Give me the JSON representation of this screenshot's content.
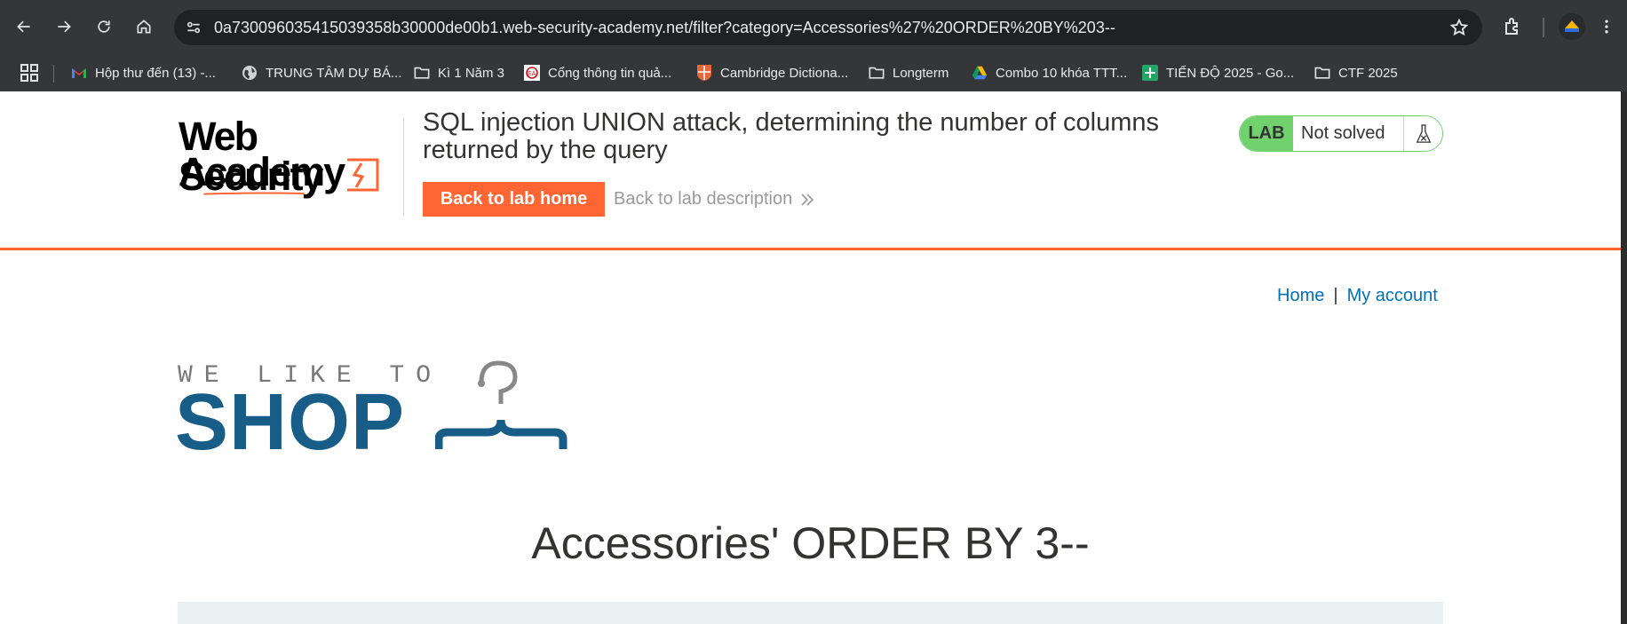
{
  "browser": {
    "url": "0a73009603541503935 8b30000de00b1.web-security-academy.net/filter?category=Accessories%27%20ORDER%20BY%203--",
    "bookmarks": [
      {
        "label": "Hộp thư đến (13) -...",
        "icon": "gmail-icon"
      },
      {
        "label": "TRUNG TÂM DỰ BÁ...",
        "icon": "globe-icon"
      },
      {
        "label": "Kì 1 Năm 3",
        "icon": "folder-icon"
      },
      {
        "label": "Cổng thông tin quả...",
        "icon": "site-icon"
      },
      {
        "label": "Cambridge Dictiona...",
        "icon": "cambridge-icon"
      },
      {
        "label": "Longterm",
        "icon": "folder-icon"
      },
      {
        "label": "Combo 10 khóa TTT...",
        "icon": "google-drive-icon"
      },
      {
        "label": "TIẾN ĐỘ 2025 - Go...",
        "icon": "google-sheets-icon"
      },
      {
        "label": "CTF 2025",
        "icon": "folder-icon"
      }
    ]
  },
  "lab": {
    "logo_line1": "Web Security",
    "logo_line2": "Academy",
    "title": "SQL injection UNION attack, determining the number of columns returned by the query",
    "back_home": "Back to lab home",
    "back_description": "Back to lab description",
    "status_tag": "LAB",
    "status_text": "Not solved",
    "colors": {
      "accent": "#ff6633",
      "status_green": "#70d16d",
      "link": "#0071bc",
      "shop_blue": "#185d88"
    }
  },
  "nav": {
    "home": "Home",
    "separator": "|",
    "account": "My account"
  },
  "shop": {
    "tagline": "WE LIKE TO",
    "word": "SHOP"
  },
  "main": {
    "heading": "Accessories' ORDER BY 3--"
  }
}
